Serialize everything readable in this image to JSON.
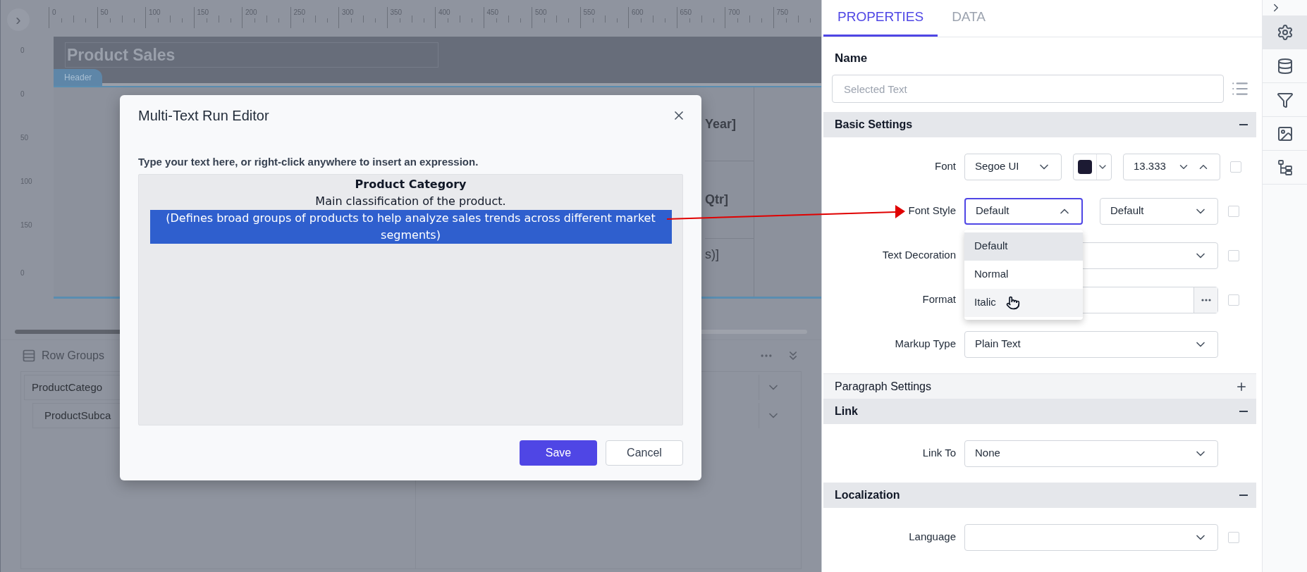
{
  "designer": {
    "expand_button": "›",
    "ruler_labels": [
      "0",
      "50",
      "100",
      "150",
      "200",
      "250",
      "300",
      "350",
      "400",
      "450",
      "500",
      "550",
      "600",
      "650",
      "700",
      "750"
    ],
    "vertical_ruler_labels": [
      "0",
      "0",
      "50",
      "100",
      "150",
      "0"
    ],
    "report_title": "Product Sales",
    "band_label": "Header",
    "partial_cells": [
      "Year]",
      "Qtr]",
      "s)]"
    ],
    "row_groups": {
      "title": "Row Groups",
      "items": [
        {
          "label": "ProductCatego",
          "children": [
            {
              "label": "ProductSubca"
            }
          ]
        }
      ]
    }
  },
  "dialog": {
    "title": "Multi-Text Run Editor",
    "instruction": "Type your text here, or right-click anywhere to insert an expression.",
    "lines": [
      {
        "kind": "heading",
        "text": "Product Category",
        "selected": false
      },
      {
        "kind": "plain",
        "text": "Main classification of the product.",
        "selected": false
      },
      {
        "kind": "plain",
        "text": "(Defines broad groups of products to help analyze sales trends across different market segments)",
        "selected": true
      }
    ],
    "buttons": [
      {
        "label": "Save",
        "kind": "primary"
      },
      {
        "label": "Cancel",
        "kind": "secondary"
      }
    ]
  },
  "properties_panel": {
    "tabs": [
      {
        "label": "PROPERTIES",
        "selected": true
      },
      {
        "label": "DATA",
        "selected": false
      }
    ],
    "name": {
      "label": "Name",
      "placeholder": "Selected Text"
    },
    "sections": [
      {
        "title": "Basic Settings",
        "expanded": true,
        "rows": [
          {
            "kind": "font",
            "label": "Font",
            "font": "Segoe UI",
            "color": "#1c1a33",
            "size": "13.333",
            "checked": false
          },
          {
            "kind": "font_style",
            "label": "Font Style",
            "style": "Default",
            "open": true,
            "weight": "Default",
            "checked": false,
            "options": [
              {
                "label": "Default",
                "selected": true,
                "hovered": false
              },
              {
                "label": "Normal",
                "selected": false,
                "hovered": false
              },
              {
                "label": "Italic",
                "selected": false,
                "hovered": true
              }
            ]
          },
          {
            "kind": "select",
            "label": "Text Decoration",
            "checked": false
          },
          {
            "kind": "format",
            "label": "Format",
            "checked": false
          },
          {
            "kind": "select",
            "label": "Markup Type",
            "value": "Plain Text"
          }
        ]
      },
      {
        "title": "Paragraph Settings",
        "expanded": false
      },
      {
        "title": "Link",
        "expanded": true,
        "rows": [
          {
            "kind": "select",
            "label": "Link To",
            "value": "None"
          }
        ]
      },
      {
        "title": "Localization",
        "expanded": true,
        "rows": [
          {
            "kind": "select",
            "label": "Language",
            "checked": false
          }
        ]
      }
    ]
  },
  "side_rail": [
    {
      "kind": "settings",
      "selected": true
    },
    {
      "kind": "database",
      "selected": false
    },
    {
      "kind": "filter",
      "selected": false
    },
    {
      "kind": "image",
      "selected": false
    },
    {
      "kind": "tree",
      "selected": false
    }
  ]
}
